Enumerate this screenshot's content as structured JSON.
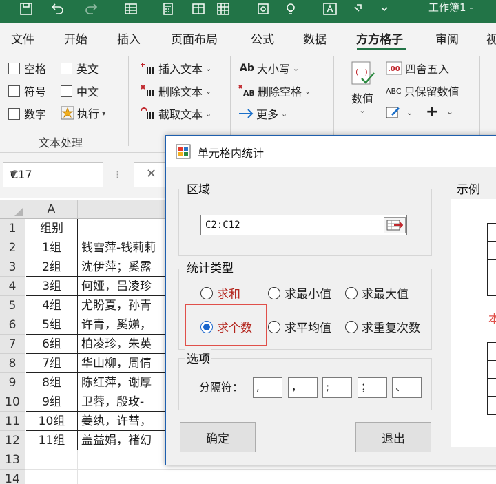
{
  "window": {
    "title_fragment": "工作簿1 -"
  },
  "quick_access": [
    "save-icon",
    "undo-icon",
    "redo-icon",
    "table-icon",
    "calculator-icon",
    "table-icon",
    "grid-icon",
    "screenshot-icon",
    "bulb-icon",
    "text-icon",
    "help-icon"
  ],
  "ribbon_tabs": [
    "文件",
    "开始",
    "插入",
    "页面布局",
    "公式",
    "数据",
    "方方格子",
    "审阅",
    "视"
  ],
  "active_tab": "方方格子",
  "ribbon": {
    "checkboxes": [
      {
        "label": "空格"
      },
      {
        "label": "英文"
      },
      {
        "label": "符号"
      },
      {
        "label": "中文"
      },
      {
        "label": "数字"
      }
    ],
    "execute": "执行",
    "text_tools": [
      "插入文本",
      "删除文本",
      "截取文本"
    ],
    "case_tools": [
      "大小写",
      "删除空格",
      "更多"
    ],
    "group_text": "文本处理",
    "numeric": {
      "value_label": "数值",
      "round": "四舍五入",
      "keep_value": "只保留数值"
    },
    "ab_glyph": "Ab",
    "abc_glyph": "ABC"
  },
  "formula_bar": {
    "name_box": "C17",
    "cancel_glyph": "✕"
  },
  "sheet": {
    "col_a": "A",
    "row_numbers": [
      "1",
      "2",
      "3",
      "4",
      "5",
      "6",
      "7",
      "8",
      "9",
      "10",
      "11",
      "12",
      "13",
      "14"
    ],
    "rows": [
      {
        "a": "组别",
        "b": ""
      },
      {
        "a": "1组",
        "b": "钱雪萍-钱莉莉"
      },
      {
        "a": "2组",
        "b": "沈伊萍；奚露"
      },
      {
        "a": "3组",
        "b": "何娅，吕凌珍"
      },
      {
        "a": "4组",
        "b": "尤盼夏，孙青"
      },
      {
        "a": "5组",
        "b": "许青，奚娣，"
      },
      {
        "a": "6组",
        "b": "柏凌珍，朱英"
      },
      {
        "a": "7组",
        "b": "华山柳，周倩"
      },
      {
        "a": "8组",
        "b": "陈红萍，谢厚"
      },
      {
        "a": "9组",
        "b": "卫蓉，殷玫-"
      },
      {
        "a": "10组",
        "b": "姜纨，许彗，"
      },
      {
        "a": "11组",
        "b": "盖益娟，褚幻"
      }
    ]
  },
  "dialog": {
    "title": "单元格内统计",
    "region_label": "区域",
    "range_value": "C2:C12",
    "stat_type_label": "统计类型",
    "stat_types": [
      {
        "label": "求和",
        "selected": false
      },
      {
        "label": "求最小值",
        "selected": false
      },
      {
        "label": "求最大值",
        "selected": false
      },
      {
        "label": "求个数",
        "selected": true
      },
      {
        "label": "求平均值",
        "selected": false
      },
      {
        "label": "求重复次数",
        "selected": false
      }
    ],
    "options_label": "选项",
    "separator_label": "分隔符：",
    "separators": [
      ",",
      "，",
      ";",
      "；",
      "、"
    ],
    "ok": "确定",
    "exit": "退出",
    "example_label": "示例",
    "example_red_text": "本"
  },
  "colors": {
    "accent": "#227447",
    "dialog_border": "#1e5fae",
    "highlight": "#e0504a",
    "radio_on": "#1a66cc"
  }
}
